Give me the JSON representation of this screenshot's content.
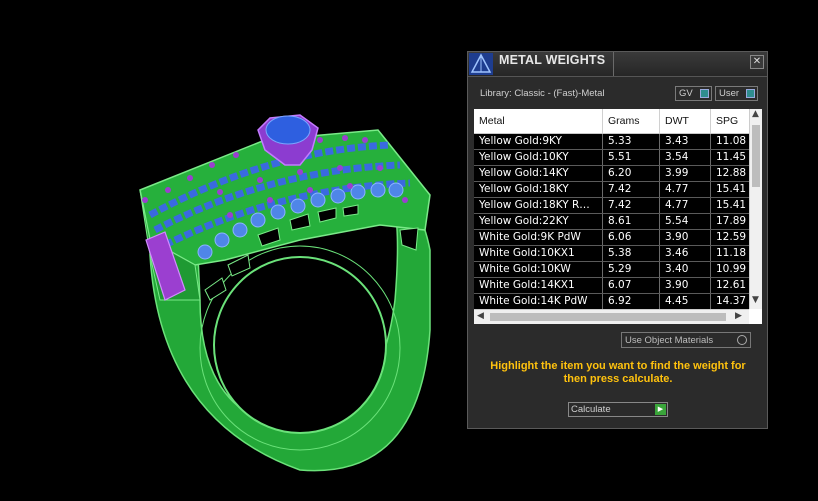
{
  "panel": {
    "title": "METAL WEIGHTS",
    "close": "✕",
    "library_text": "Library: Classic - (Fast)-Metal",
    "gv_label": "GV",
    "user_label": "User",
    "columns": [
      "Metal",
      "Grams",
      "DWT",
      "SPG"
    ],
    "rows": [
      [
        "Yellow Gold:9KY",
        "5.33",
        "3.43",
        "11.08"
      ],
      [
        "Yellow Gold:10KY",
        "5.51",
        "3.54",
        "11.45"
      ],
      [
        "Yellow Gold:14KY",
        "6.20",
        "3.99",
        "12.88"
      ],
      [
        "Yellow Gold:18KY",
        "7.42",
        "4.77",
        "15.41"
      ],
      [
        "Yellow Gold:18KY R…",
        "7.42",
        "4.77",
        "15.41"
      ],
      [
        "Yellow Gold:22KY",
        "8.61",
        "5.54",
        "17.89"
      ],
      [
        "White Gold:9K PdW",
        "6.06",
        "3.90",
        "12.59"
      ],
      [
        "White Gold:10KX1",
        "5.38",
        "3.46",
        "11.18"
      ],
      [
        "White Gold:10KW",
        "5.29",
        "3.40",
        "10.99"
      ],
      [
        "White Gold:14KX1",
        "6.07",
        "3.90",
        "12.61"
      ],
      [
        "White Gold:14K PdW",
        "6.92",
        "4.45",
        "14.37"
      ]
    ],
    "use_object_materials": "Use Object Materials",
    "instruction": "Highlight the item you want to find the weight for then press calculate.",
    "calculate_label": "Calculate",
    "accent_color": "#ffc20e",
    "icons": [
      "logo-icon",
      "close-icon",
      "scroll-up-icon",
      "scroll-down-icon",
      "scroll-left-icon",
      "scroll-right-icon",
      "go-icon"
    ]
  },
  "viewport": {
    "model": "ring",
    "colors": {
      "metal": "#3ecb5a",
      "stones": "#4d7fe0",
      "prongs": "#9b3fd0"
    }
  }
}
